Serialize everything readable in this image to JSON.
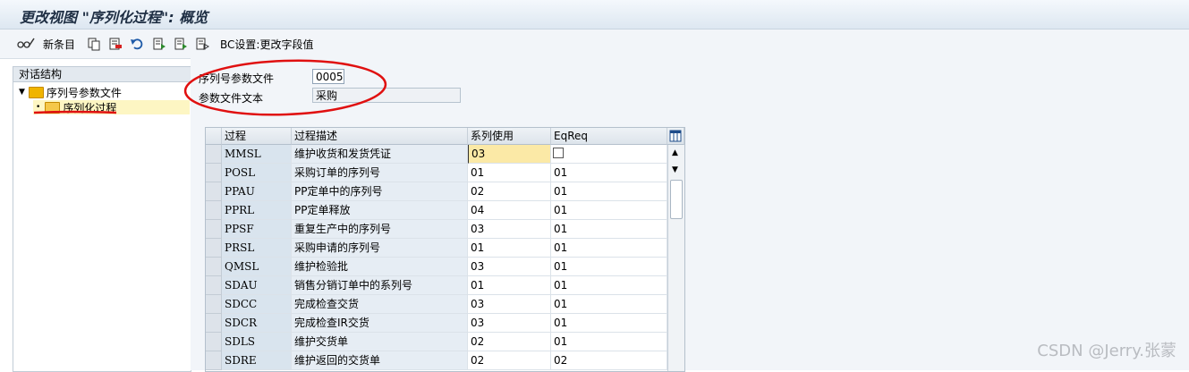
{
  "window": {
    "title": "更改视图 \"序列化过程\": 概览"
  },
  "toolbar": {
    "new_entries": "新条目",
    "bc_settings": "BC设置:更改字段值"
  },
  "tree": {
    "header": "对话结构",
    "items": [
      {
        "label": "序列号参数文件"
      },
      {
        "label": "序列化过程"
      }
    ]
  },
  "form": {
    "profile_label": "序列号参数文件",
    "profile_value": "0005",
    "text_label": "参数文件文本",
    "text_value": "采购"
  },
  "table": {
    "columns": [
      "过程",
      "过程描述",
      "系列使用",
      "EqReq"
    ],
    "rows": [
      [
        "MMSL",
        "维护收货和发货凭证",
        "03",
        ""
      ],
      [
        "POSL",
        "采购订单的序列号",
        "01",
        "01"
      ],
      [
        "PPAU",
        "PP定单中的序列号",
        "02",
        "01"
      ],
      [
        "PPRL",
        "PP定单释放",
        "04",
        "01"
      ],
      [
        "PPSF",
        "重复生产中的序列号",
        "03",
        "01"
      ],
      [
        "PRSL",
        "采购申请的序列号",
        "01",
        "01"
      ],
      [
        "QMSL",
        "维护检验批",
        "03",
        "01"
      ],
      [
        "SDAU",
        "销售分销订单中的系列号",
        "01",
        "01"
      ],
      [
        "SDCC",
        "完成检查交货",
        "03",
        "01"
      ],
      [
        "SDCR",
        "完成检查IR交货",
        "03",
        "01"
      ],
      [
        "SDLS",
        "维护交货单",
        "02",
        "01"
      ],
      [
        "SDRE",
        "维护返回的交货单",
        "02",
        "02"
      ]
    ]
  },
  "watermark": "CSDN @Jerry.张蒙",
  "colors": {
    "annotation": "#e01010",
    "selected_tree": "#fdf6c3",
    "active_cell": "#fbe9a6"
  }
}
